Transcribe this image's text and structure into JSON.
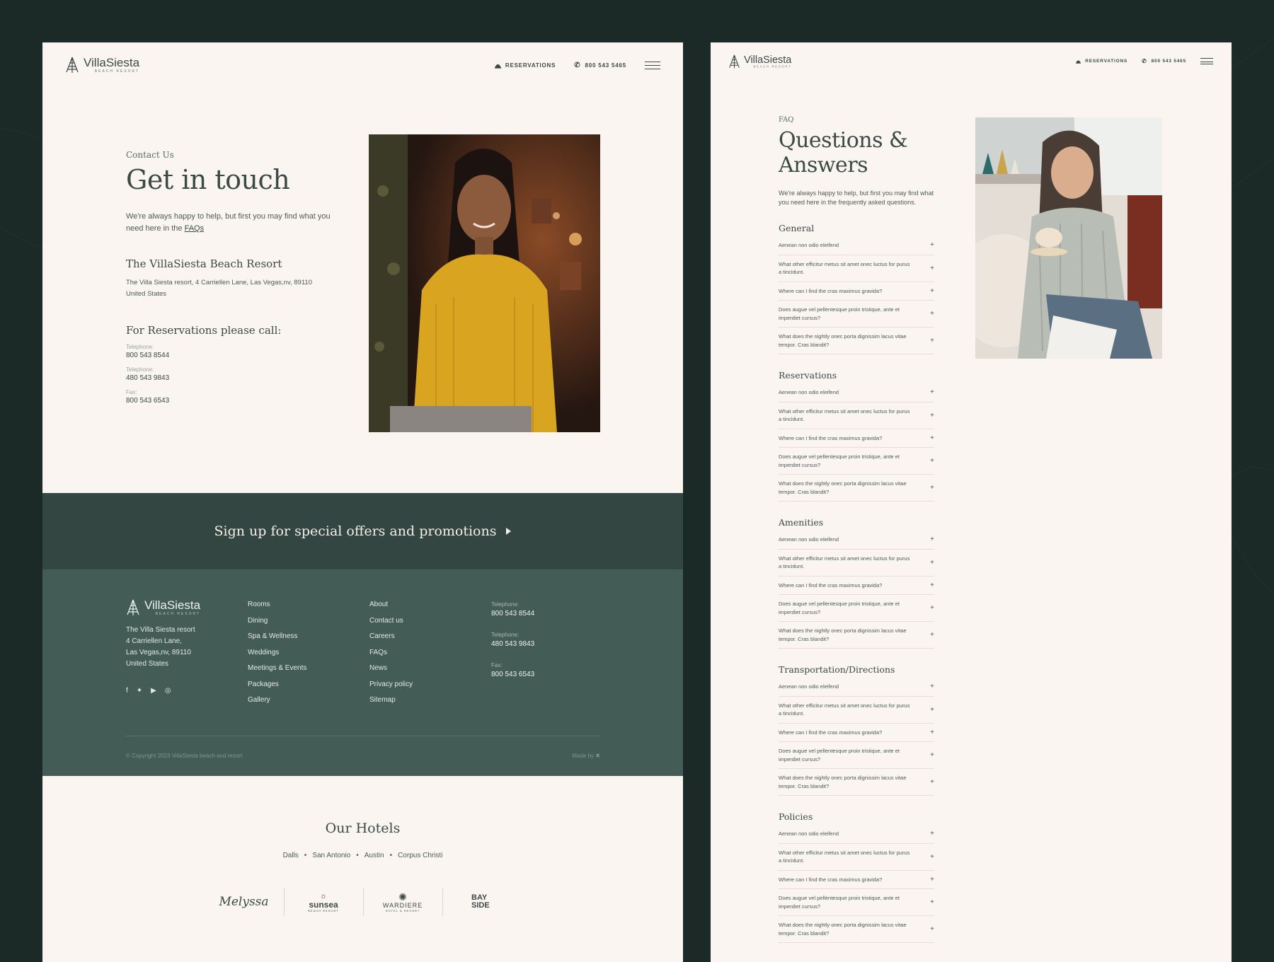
{
  "brand": {
    "name": "VillaSiesta",
    "tagline": "BEACH RESORT"
  },
  "nav": {
    "reservations": "RESERVATIONS",
    "phone": "800 543 5465"
  },
  "contact": {
    "eyebrow": "Contact Us",
    "title": "Get in touch",
    "intro": "We're always happy to help, but first you may find what you need here in the",
    "faq_link": "FAQs",
    "resort_name": "The VillaSiesta Beach Resort",
    "address_line1": "The Villa Siesta resort, 4 Carriellen Lane, Las Vegas,nv, 89110",
    "address_line2": "United States",
    "reservations_title": "For Reservations please call:",
    "phones": [
      {
        "label": "Telephone:",
        "value": "800 543 8544"
      },
      {
        "label": "Telephone:",
        "value": "480 543 9843"
      },
      {
        "label": "Fax:",
        "value": "800 543 6543"
      }
    ]
  },
  "signup": {
    "text": "Sign up for special offers and promotions"
  },
  "footer": {
    "address": [
      "The Villa Siesta resort",
      "4 Carriellen Lane,",
      "Las Vegas,nv, 89110",
      "United States"
    ],
    "links_col1": [
      "Rooms",
      "Dining",
      "Spa & Wellness",
      "Weddings",
      "Meetings & Events",
      "Packages",
      "Gallery"
    ],
    "links_col2": [
      "About",
      "Contact us",
      "Careers",
      "FAQs",
      "News",
      "Privacy policy",
      "Sitemap"
    ],
    "phones": [
      {
        "label": "Telephone:",
        "value": "800 543 8544"
      },
      {
        "label": "Telephone:",
        "value": "480 543 9843"
      },
      {
        "label": "Fax:",
        "value": "800 543 6543"
      }
    ],
    "copyright": "© Copyright 2023 VillaSiesta beach and resort",
    "made_by": "Made by"
  },
  "hotels": {
    "title": "Our Hotels",
    "cities": [
      "Dalls",
      "San Antonio",
      "Austin",
      "Corpus Christi"
    ],
    "bullet": "•",
    "brands": [
      {
        "name": "Melyssa",
        "sub": ""
      },
      {
        "name": "sunsea",
        "sub": "BEACH RESORT"
      },
      {
        "name": "WARDIERE",
        "sub": "HOTEL & RESORT"
      },
      {
        "name": "BAY SIDE",
        "sub": ""
      }
    ]
  },
  "faq": {
    "eyebrow": "FAQ",
    "title_line1": "Questions &",
    "title_line2": "Answers",
    "intro": "We're always happy to help, but first you may find what you need here in the frequently asked questions.",
    "questions": [
      "Aenean non odio eleifend",
      "What other efficitur metus sit amet onec luctus for purus a tincidunt.",
      "Where can I find the cras maximus gravida?",
      "Does augue vel pellentesque proin tristique, ante et imperdiet cursus?",
      "What does the nightly onec porta dignissim lacus vitae tempor. Cras blandit?"
    ],
    "sections": [
      "General",
      "Reservations",
      "Amenities",
      "Transportation/Directions",
      "Policies"
    ]
  },
  "icons": {
    "bell": "bell-icon",
    "phone": "phone-icon",
    "menu": "menu-icon",
    "plus": "+",
    "arrow": "arrow-right-icon"
  },
  "colors": {
    "page_bg": "#1b2a26",
    "panel_bg": "#fbf5f2",
    "signup_bg": "#334641",
    "footer_bg": "#445c56",
    "text": "#3b4a46"
  }
}
